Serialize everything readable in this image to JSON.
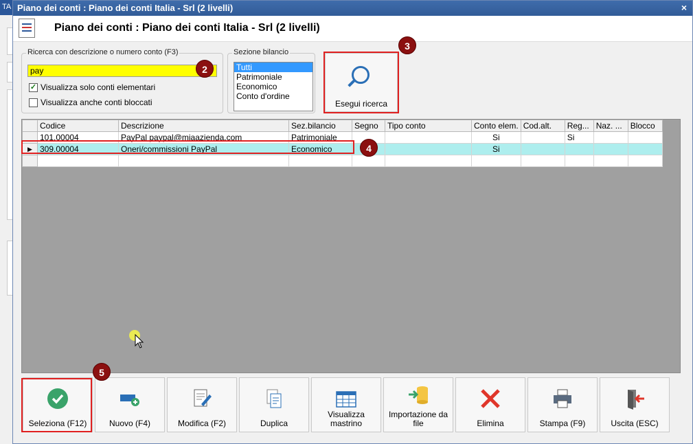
{
  "background_app": {
    "title_fragment": "TA"
  },
  "window": {
    "title": "Piano dei conti : Piano dei conti Italia - Srl (2 livelli)",
    "close_glyph": "×",
    "header_title": "Piano dei conti : Piano dei conti Italia - Srl (2 livelli)"
  },
  "search": {
    "legend": "Ricerca con descrizione o numero conto (F3)",
    "value": "pay",
    "only_elementary_label": "Visualizza solo conti elementari",
    "only_elementary_checked": true,
    "show_blocked_label": "Visualizza anche conti bloccati",
    "show_blocked_checked": false
  },
  "section": {
    "legend": "Sezione bilancio",
    "options": [
      "Tutti",
      "Patrimoniale",
      "Economico",
      "Conto d'ordine"
    ],
    "selected": "Tutti"
  },
  "search_button": {
    "label": "Esegui ricerca"
  },
  "badges": [
    "2",
    "3",
    "4",
    "5"
  ],
  "grid": {
    "columns": [
      "Codice",
      "Descrizione",
      "Sez.bilancio",
      "Segno",
      "Tipo conto",
      "Conto elem.",
      "Cod.alt.",
      "Reg...",
      "Naz. ...",
      "Blocco"
    ],
    "rows": [
      {
        "codice": "101.00004",
        "descrizione": "PayPal paypal@miaazienda.com",
        "sez": "Patrimoniale",
        "segno": "",
        "tipo": "",
        "elem": "Si",
        "codalt": "",
        "reg": "Si",
        "naz": "",
        "blocco": "",
        "selected": false
      },
      {
        "codice": "309.00004",
        "descrizione": "Oneri/commissioni PayPal",
        "sez": "Economico",
        "segno": "",
        "tipo": "",
        "elem": "Si",
        "codalt": "",
        "reg": "",
        "naz": "",
        "blocco": "",
        "selected": true
      }
    ],
    "row_indicator": "▶"
  },
  "buttons": [
    {
      "label": "Seleziona (F12)",
      "icon": "check-circle-icon"
    },
    {
      "label": "Nuovo (F4)",
      "icon": "new-record-icon"
    },
    {
      "label": "Modifica (F2)",
      "icon": "edit-document-icon"
    },
    {
      "label": "Duplica",
      "icon": "duplicate-icon"
    },
    {
      "label": "Visualizza mastrino",
      "icon": "ledger-table-icon"
    },
    {
      "label": "Importazione da file",
      "icon": "import-file-icon"
    },
    {
      "label": "Elimina",
      "icon": "delete-x-icon"
    },
    {
      "label": "Stampa (F9)",
      "icon": "printer-icon"
    },
    {
      "label": "Uscita (ESC)",
      "icon": "exit-door-icon"
    }
  ],
  "colors": {
    "accent": "#2b579a",
    "highlight_red": "#e01f1f",
    "badge": "#8b1010",
    "selected_row": "#aeeeee",
    "search_bg": "#ffff00"
  }
}
